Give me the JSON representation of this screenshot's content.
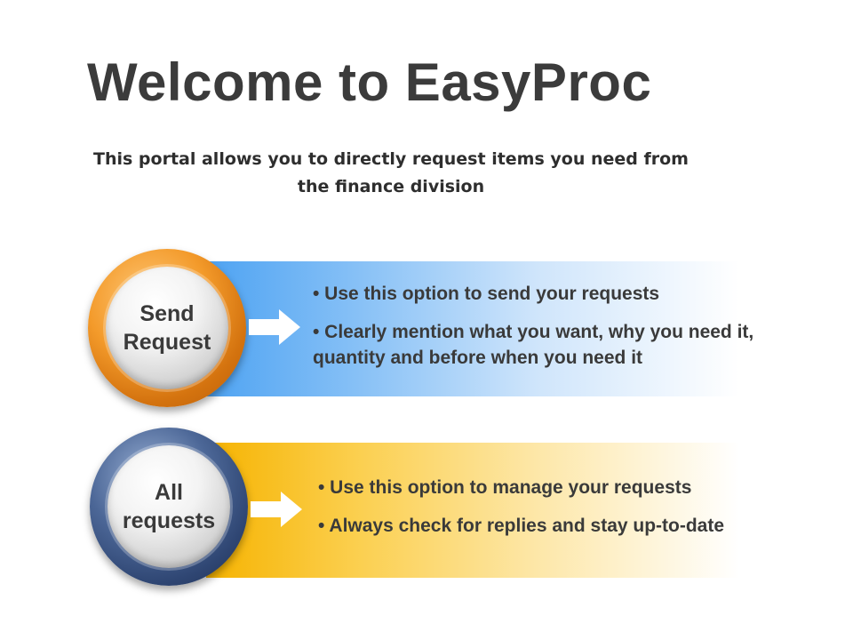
{
  "header": {
    "title": "Welcome to EasyProc",
    "subtitle": "This portal allows you to directly request items you need from the finance division"
  },
  "options": [
    {
      "label_line1": "Send",
      "label_line2": "Request",
      "ring_color": "#f39a2a",
      "band_color": "#4ea3f2",
      "bullets": [
        "• Use this option to send your requests",
        "• Clearly mention what you want, why you need it, quantity and before when you need it"
      ]
    },
    {
      "label_line1": "All",
      "label_line2": "requests",
      "ring_color": "#2f4673",
      "band_color": "#f6b300",
      "bullets": [
        "• Use this option to manage your requests",
        "• Always check for replies and stay up-to-date"
      ]
    }
  ],
  "icons": {
    "arrow": "arrow-right-icon"
  }
}
